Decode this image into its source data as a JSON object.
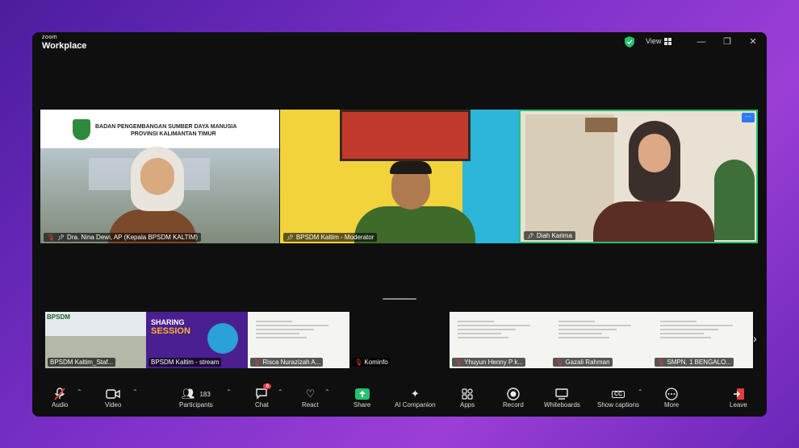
{
  "app": {
    "brand_small": "zoom",
    "brand_large": "Workplace"
  },
  "titlebar": {
    "view_label": "View"
  },
  "speakers": [
    {
      "name": "Dra. Nina Dewi, AP (Kepala BPSDM KALTIM)",
      "banner_line1": "BADAN PENGEMBANGAN SUMBER DAYA MANUSIA",
      "banner_line2": "PROVINSI KALIMANTAN TIMUR"
    },
    {
      "name": "BPSDM Kaltim - Moderator"
    },
    {
      "name": "Diah Karima"
    }
  ],
  "more_glyph": "···",
  "strip": [
    {
      "name": "BPSDM Kaltim_Staf...",
      "logo": "BPSDM"
    },
    {
      "name": "BPSDM Kaltim - stream",
      "title1": "SHARING",
      "title2": "SESSION"
    },
    {
      "name": "Risca Nurazizah A..."
    },
    {
      "name": "Kominfo"
    },
    {
      "name": "Yhuyun Henny P k..."
    },
    {
      "name": "Gazali Rahman"
    },
    {
      "name": "SMPN. 1 BENGALO..."
    }
  ],
  "toolbar": {
    "audio": "Audio",
    "video": "Video",
    "participants": "Participants",
    "participants_count": "183",
    "chat": "Chat",
    "chat_badge": "6",
    "react": "React",
    "share": "Share",
    "ai_companion": "AI Companion",
    "apps": "Apps",
    "record": "Record",
    "whiteboards": "Whiteboards",
    "show_captions": "Show captions",
    "captions_glyph": "CC",
    "more": "More",
    "leave": "Leave"
  },
  "colors": {
    "accent_green": "#25c16f",
    "accent_blue": "#2d7bf4",
    "leave_red": "#e23c3c"
  }
}
